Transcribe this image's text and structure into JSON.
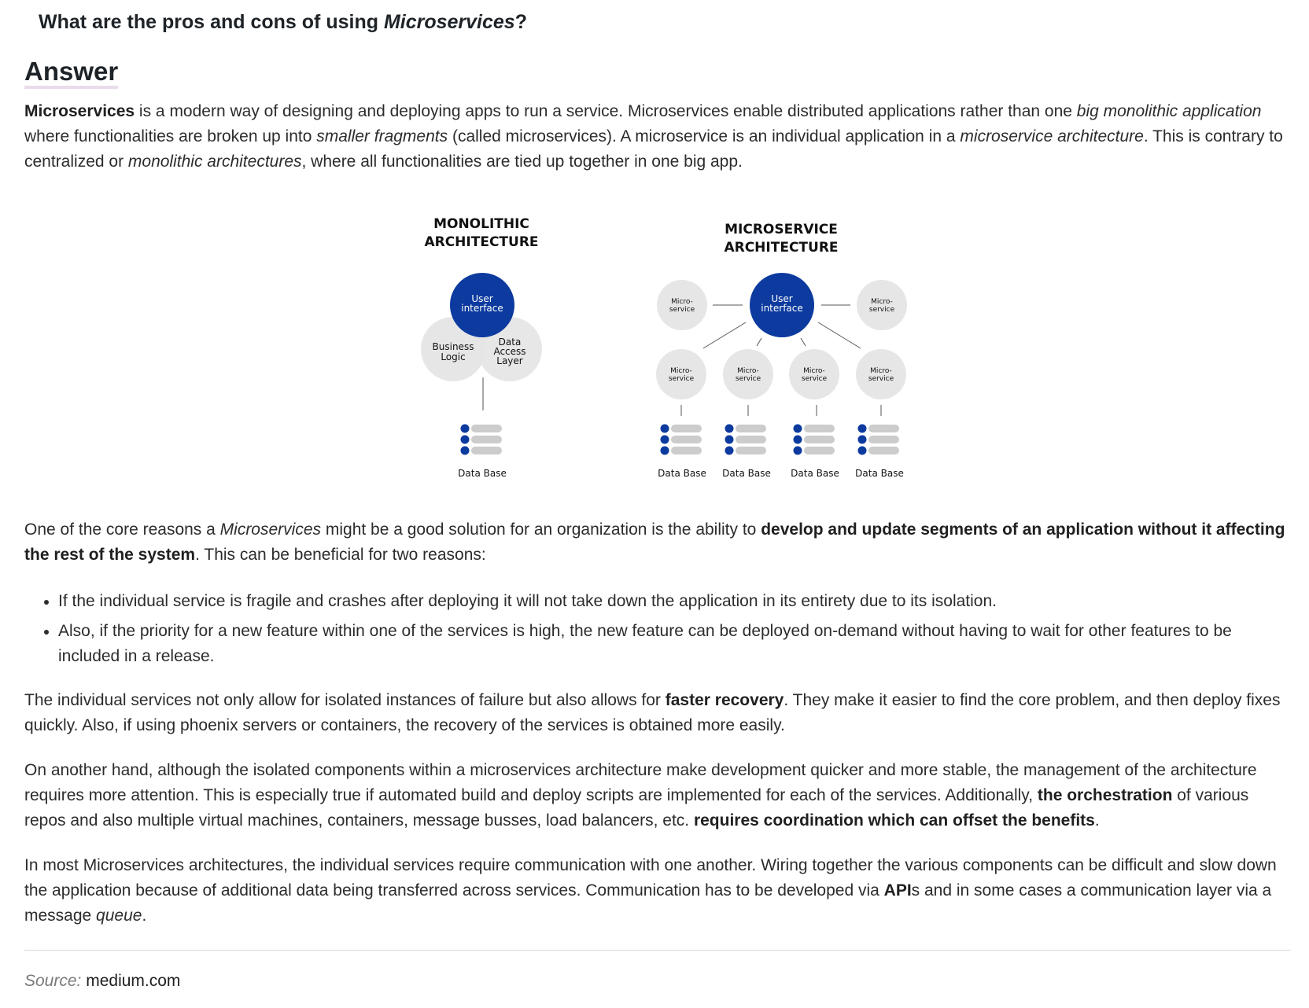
{
  "question": {
    "prefix": "What are the pros and cons of using ",
    "em": "Microservices",
    "suffix": "?"
  },
  "answer_heading": "Answer",
  "intro": {
    "b1": "Microservices",
    "t1": " is a modern way of designing and deploying apps to run a service. Microservices enable distributed applications rather than one ",
    "i1": "big monolithic application",
    "t2": " where functionalities are broken up into ",
    "i2": "smaller fragments",
    "t3": " (called microservices). A microservice is an individual application in a ",
    "i3": "microservice architecture",
    "t4": ". This is contrary to centralized or ",
    "i4": "monolithic architectures",
    "t5": ", where all functionalities are tied up together in one big app."
  },
  "diagram": {
    "mono_title": [
      "MONOLITHIC",
      "ARCHITECTURE"
    ],
    "micro_title": [
      "MICROSERVICE",
      "ARCHITECTURE"
    ],
    "ui_label": [
      "User",
      "interface"
    ],
    "business_logic": [
      "Business",
      "Logic"
    ],
    "data_access": [
      "Data",
      "Access",
      "Layer"
    ],
    "microservice": [
      "Micro-",
      "service"
    ],
    "db_label": "Data Base",
    "colors": {
      "blue": "#0c3a9e",
      "grey": "#e6e6e6",
      "bar": "#cccccc"
    }
  },
  "p2": {
    "t1": "One of the core reasons a ",
    "i1": "Microservices",
    "t2": " might be a good solution for an organization is the ability to ",
    "b1": "develop and update segments of an application without it affecting the rest of the system",
    "t3": ". This can be beneficial for two reasons:"
  },
  "bullets": [
    "If the individual service is fragile and crashes after deploying it will not take down the application in its entirety due to its isolation.",
    "Also, if the priority for a new feature within one of the services is high, the new feature can be deployed on-demand without having to wait for other features to be included in a release."
  ],
  "p3": {
    "t1": "The individual services not only allow for isolated instances of failure but also allows for ",
    "b1": "faster recovery",
    "t2": ". They make it easier to find the core problem, and then deploy fixes quickly. Also, if using phoenix servers or containers, the recovery of the services is obtained more easily."
  },
  "p4": {
    "t1": "On another hand, although the isolated components within a microservices architecture make development quicker and more stable, the management of the architecture requires more attention. This is especially true if automated build and deploy scripts are implemented for each of the services. Additionally, ",
    "b1": "the orchestration",
    "t2": " of various repos and also multiple virtual machines, containers, message busses, load balancers, etc. ",
    "b2": "requires coordination which can offset the benefits",
    "t3": "."
  },
  "p5": {
    "t1": "In most Microservices architectures, the individual services require communication with one another. Wiring together the various components can be difficult and slow down the application because of additional data being transferred across services. Communication has to be developed via ",
    "b1": "API",
    "t2": "s and in some cases a communication layer via a message ",
    "i1": "queue",
    "t3": "."
  },
  "source": {
    "label": "Source:",
    "value": "medium.com"
  }
}
